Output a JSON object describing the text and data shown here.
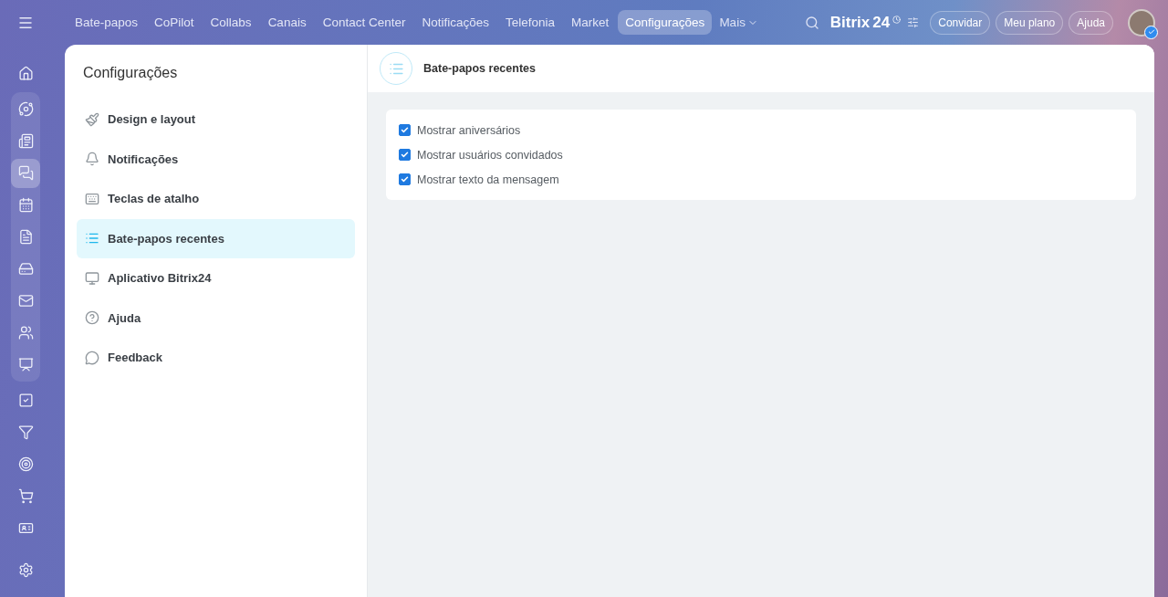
{
  "top_nav": {
    "items": [
      {
        "label": "Bate-papos",
        "selected": false
      },
      {
        "label": "CoPilot",
        "selected": false
      },
      {
        "label": "Collabs",
        "selected": false
      },
      {
        "label": "Canais",
        "selected": false
      },
      {
        "label": "Contact Center",
        "selected": false
      },
      {
        "label": "Notificações",
        "selected": false
      },
      {
        "label": "Telefonia",
        "selected": false
      },
      {
        "label": "Market",
        "selected": false
      },
      {
        "label": "Configurações",
        "selected": true
      }
    ],
    "more": "Mais",
    "logo": "Bitrix",
    "logo_number": "24",
    "buttons": [
      "Convidar",
      "Meu plano",
      "Ajuda"
    ]
  },
  "rail": {
    "top": [
      {
        "kind": "home",
        "selected": false
      }
    ],
    "grouped": [
      {
        "kind": "feed",
        "selected": false
      },
      {
        "kind": "news",
        "selected": false
      },
      {
        "kind": "chat",
        "selected": true
      },
      {
        "kind": "calendar",
        "selected": false
      },
      {
        "kind": "file",
        "selected": false
      },
      {
        "kind": "drive",
        "selected": false
      },
      {
        "kind": "mail",
        "selected": false
      },
      {
        "kind": "users",
        "selected": false
      },
      {
        "kind": "presentation",
        "selected": false
      }
    ],
    "rest": [
      {
        "kind": "task",
        "selected": false
      },
      {
        "kind": "funnel",
        "selected": false
      },
      {
        "kind": "target",
        "selected": false
      },
      {
        "kind": "cart",
        "selected": false
      },
      {
        "kind": "card",
        "selected": false
      }
    ],
    "bottom": [
      {
        "kind": "settings",
        "selected": false
      }
    ]
  },
  "settings": {
    "title": "Configurações",
    "items": [
      {
        "kind": "design",
        "label": "Design e layout",
        "selected": false
      },
      {
        "kind": "bell",
        "label": "Notificações",
        "selected": false
      },
      {
        "kind": "keyboard",
        "label": "Teclas de atalho",
        "selected": false
      },
      {
        "kind": "list",
        "label": "Bate-papos recentes",
        "selected": true
      },
      {
        "kind": "monitor",
        "label": "Aplicativo Bitrix24",
        "selected": false
      },
      {
        "kind": "help",
        "label": "Ajuda",
        "selected": false
      },
      {
        "kind": "feedback",
        "label": "Feedback",
        "selected": false
      }
    ]
  },
  "content": {
    "title": "Bate-papos recentes",
    "options": [
      {
        "label": "Mostrar aniversários",
        "checked": true
      },
      {
        "label": "Mostrar usuários convidados",
        "checked": true
      },
      {
        "label": "Mostrar texto da mensagem",
        "checked": true
      }
    ]
  }
}
